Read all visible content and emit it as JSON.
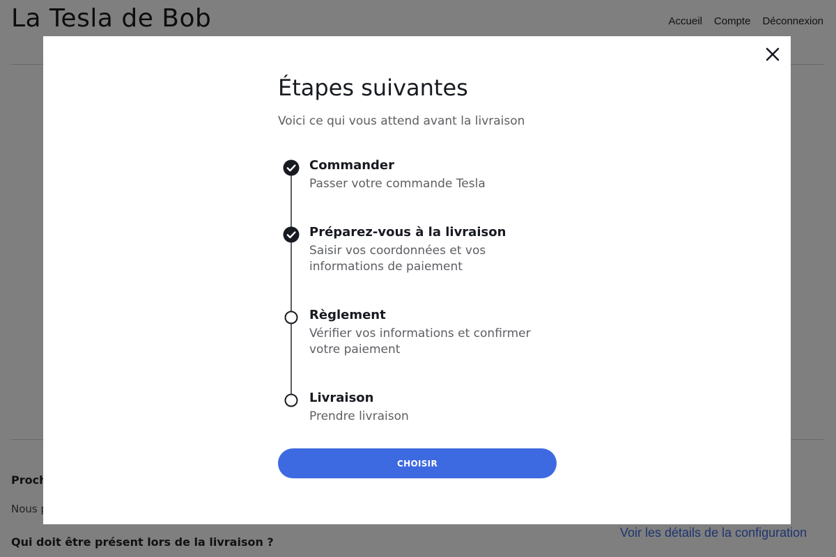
{
  "header": {
    "site_title": "La Tesla de Bob",
    "nav": [
      {
        "label": "Accueil"
      },
      {
        "label": "Compte"
      },
      {
        "label": "Déconnexion"
      }
    ]
  },
  "background": {
    "heading": "Proch",
    "text": "Nous p",
    "question": "Qui doit être présent lors de la livraison ?",
    "config_link": "Voir les détails de la configuration"
  },
  "modal": {
    "title": "Étapes suivantes",
    "subtitle": "Voici ce qui vous attend avant la livraison",
    "close_icon": "close-icon",
    "steps": [
      {
        "title": "Commander",
        "description": "Passer votre commande Tesla",
        "status": "completed"
      },
      {
        "title": "Préparez-vous à la livraison",
        "description": "Saisir vos coordonnées et vos informations de paiement",
        "status": "completed"
      },
      {
        "title": "Règlement",
        "description": "Vérifier vos informations et confirmer votre paiement",
        "status": "pending"
      },
      {
        "title": "Livraison",
        "description": "Prendre livraison",
        "status": "pending"
      }
    ],
    "button_label": "CHOISIR"
  },
  "colors": {
    "accent": "#3e6ae1",
    "text_primary": "#171a20",
    "text_secondary": "#5c5e62",
    "overlay": "rgba(0,0,0,0.5)"
  }
}
